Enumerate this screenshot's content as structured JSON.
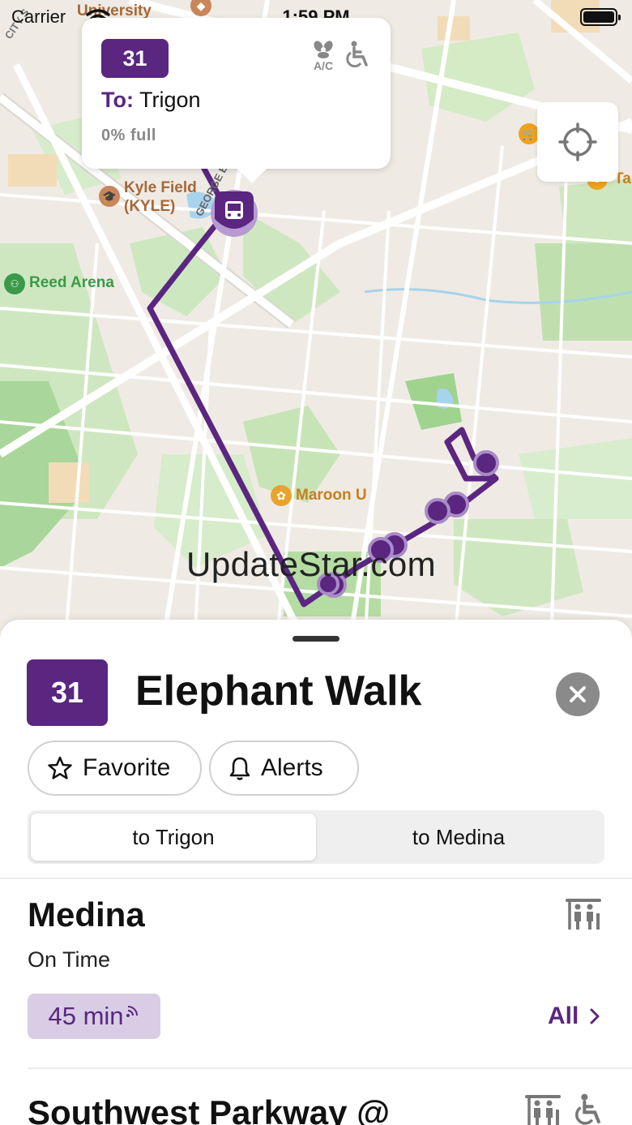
{
  "status_bar": {
    "carrier": "Carrier",
    "time": "1:59 PM"
  },
  "map": {
    "labels": {
      "university": "University",
      "kyle_field": "Kyle Field",
      "kyle_code": "(KYLE)",
      "reed_arena": "Reed Arena",
      "maroon_u": "Maroon U",
      "ta": "Ta",
      "george_bush": "GEORGE BUSH",
      "city_street": "CITY S"
    },
    "route_color": "#5a2680"
  },
  "callout": {
    "route_number": "31",
    "to_label": "To:",
    "destination": "Trigon",
    "capacity": "0% full",
    "icons": [
      "ac-fan-icon",
      "wheelchair-icon"
    ],
    "ac_text": "A/C"
  },
  "watermark": "UpdateStar.com",
  "sheet": {
    "route_number": "31",
    "route_name": "Elephant Walk",
    "favorite_label": "Favorite",
    "alerts_label": "Alerts",
    "directions": [
      {
        "label": "to Trigon",
        "selected": true
      },
      {
        "label": "to Medina",
        "selected": false
      }
    ],
    "stops": [
      {
        "name": "Medina",
        "status": "On Time",
        "time": "45 min",
        "all_label": "All",
        "icons": [
          "bus-shelter-icon"
        ]
      },
      {
        "name": "Southwest Parkway @",
        "icons": [
          "bus-shelter-icon",
          "wheelchair-icon"
        ]
      }
    ]
  },
  "colors": {
    "accent": "#5a2680",
    "time_chip_bg": "#d9cde6"
  }
}
